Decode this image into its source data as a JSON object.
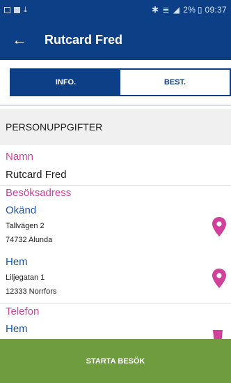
{
  "status_bar": {
    "time_battery": "2% ▯ 09:37"
  },
  "app_bar": {
    "title": "Rutcard Fred"
  },
  "tabs": [
    {
      "label": "INFO."
    },
    {
      "label": "BEST."
    }
  ],
  "section": {
    "title": "PERSONUPPGIFTER"
  },
  "person": {
    "name_label": "Namn",
    "name": "Rutcard Fred",
    "visit_address_label": "Besöksadress",
    "addresses": [
      {
        "type": "Okänd",
        "street": "Tallvägen 2",
        "city": "74732 Alunda"
      },
      {
        "type": "Hem",
        "street": "Liljegatan 1",
        "city": "12333 Norrfors"
      }
    ],
    "phone_label": "Telefon",
    "phone_type": "Hem"
  },
  "actions": {
    "start_visit": "STARTA BESÖK"
  },
  "colors": {
    "primary": "#0d3f86",
    "label": "#d1409a",
    "sublabel": "#1c56a6",
    "action": "#6e9c3e"
  }
}
